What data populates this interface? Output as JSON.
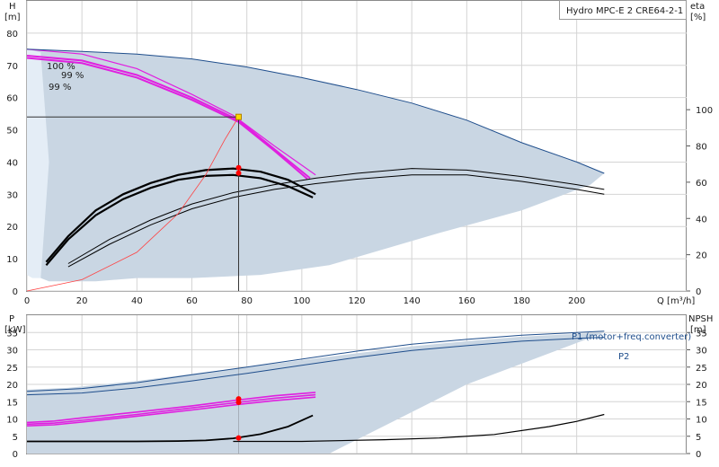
{
  "colors": {
    "area": "#c9d6e3",
    "area_light": "#e4edf6",
    "blue_line": "#1f4e8c",
    "magenta": "#e020e0",
    "black": "#000000",
    "red": "#ff0000",
    "red_curve": "#ff4040",
    "marker_fill": "#ffd700",
    "op_line": "#333333"
  },
  "chart_data": [
    {
      "type": "line",
      "id": "head",
      "title": "Hydro MPC-E 2 CRE64-2-1",
      "ylabel": "H",
      "yunit": "[m]",
      "xlabel": "Q [m³/h]",
      "xlim": [
        0,
        240
      ],
      "ylim": [
        0,
        90
      ],
      "xticks": [
        0,
        20,
        40,
        60,
        80,
        100,
        120,
        140,
        160,
        180,
        200
      ],
      "yticks": [
        0,
        10,
        20,
        30,
        40,
        50,
        60,
        70,
        80
      ],
      "right_axis": {
        "label": "eta",
        "unit": "[%]",
        "ylim": [
          0,
          160
        ],
        "ticks": [
          0,
          20,
          40,
          60,
          80,
          100
        ]
      },
      "grid": true,
      "envelope": [
        [
          0,
          75
        ],
        [
          20,
          74.3
        ],
        [
          40,
          73.5
        ],
        [
          60,
          72
        ],
        [
          80,
          69.5
        ],
        [
          100,
          66.2
        ],
        [
          120,
          62.5
        ],
        [
          140,
          58.3
        ],
        [
          160,
          53
        ],
        [
          180,
          46
        ],
        [
          200,
          40
        ],
        [
          210,
          36.5
        ],
        [
          205,
          33
        ],
        [
          180,
          25
        ],
        [
          150,
          18
        ],
        [
          110,
          8
        ],
        [
          85,
          5
        ],
        [
          60,
          4
        ],
        [
          40,
          4
        ],
        [
          25,
          3
        ],
        [
          15,
          3
        ],
        [
          8,
          3
        ],
        [
          5,
          4
        ],
        [
          2,
          22
        ],
        [
          0,
          70
        ]
      ],
      "envelope_light": [
        [
          0,
          75
        ],
        [
          5,
          74
        ],
        [
          8,
          40
        ],
        [
          5,
          4
        ],
        [
          2,
          4
        ],
        [
          0,
          5
        ]
      ],
      "series": [
        {
          "name": "100 %",
          "color": "magenta",
          "points": [
            [
              0,
              75
            ],
            [
              20,
              73.5
            ],
            [
              40,
              69
            ],
            [
              60,
              61
            ],
            [
              75,
              54.5
            ],
            [
              90,
              45
            ],
            [
              105,
              36
            ]
          ]
        },
        {
          "name": "99 %",
          "color": "magenta",
          "points": [
            [
              0,
              73
            ],
            [
              20,
              71.5
            ],
            [
              40,
              67
            ],
            [
              60,
              60
            ],
            [
              77,
              53
            ],
            [
              90,
              44
            ],
            [
              103,
              35
            ]
          ]
        },
        {
          "name": "99 %",
          "color": "magenta",
          "points": [
            [
              0,
              72.3
            ],
            [
              20,
              70.7
            ],
            [
              40,
              66.2
            ],
            [
              60,
              59.3
            ],
            [
              77,
              52.4
            ],
            [
              90,
              43.5
            ],
            [
              102,
              34.8
            ]
          ]
        },
        {
          "color": "blue_line",
          "points": [
            [
              0,
              75
            ],
            [
              20,
              74.3
            ],
            [
              40,
              73.5
            ],
            [
              60,
              72
            ],
            [
              80,
              69.5
            ],
            [
              100,
              66.2
            ],
            [
              120,
              62.5
            ],
            [
              140,
              58.3
            ],
            [
              160,
              53
            ],
            [
              180,
              46
            ],
            [
              200,
              40
            ],
            [
              210,
              36.5
            ]
          ]
        },
        {
          "color": "black",
          "points": [
            [
              7,
              9
            ],
            [
              15,
              17
            ],
            [
              25,
              25
            ],
            [
              35,
              30
            ],
            [
              45,
              33.5
            ],
            [
              55,
              36
            ],
            [
              65,
              37.5
            ],
            [
              75,
              38
            ],
            [
              85,
              37
            ],
            [
              95,
              34.5
            ],
            [
              105,
              30
            ]
          ]
        },
        {
          "color": "black",
          "points": [
            [
              7,
              8
            ],
            [
              15,
              16
            ],
            [
              25,
              23.5
            ],
            [
              35,
              28.5
            ],
            [
              45,
              32
            ],
            [
              55,
              34.5
            ],
            [
              65,
              35.7
            ],
            [
              75,
              36
            ],
            [
              85,
              35
            ],
            [
              95,
              32.5
            ],
            [
              104,
              29
            ]
          ]
        },
        {
          "color": "black",
          "points": [
            [
              15,
              8.5
            ],
            [
              30,
              16
            ],
            [
              45,
              22
            ],
            [
              60,
              27
            ],
            [
              75,
              30.5
            ],
            [
              90,
              33
            ],
            [
              105,
              35
            ],
            [
              120,
              36.5
            ],
            [
              140,
              38
            ],
            [
              160,
              37.5
            ],
            [
              180,
              35.5
            ],
            [
              200,
              33
            ],
            [
              210,
              31.5
            ]
          ]
        },
        {
          "color": "black",
          "points": [
            [
              15,
              7.5
            ],
            [
              30,
              14.5
            ],
            [
              45,
              20.5
            ],
            [
              60,
              25.5
            ],
            [
              75,
              29
            ],
            [
              90,
              31.5
            ],
            [
              105,
              33.3
            ],
            [
              120,
              34.7
            ],
            [
              140,
              36
            ],
            [
              160,
              36
            ],
            [
              180,
              34
            ],
            [
              200,
              31.5
            ],
            [
              210,
              30
            ]
          ]
        },
        {
          "color": "red_curve",
          "points": [
            [
              0,
              0
            ],
            [
              20,
              3.5
            ],
            [
              40,
              12
            ],
            [
              55,
              24
            ],
            [
              65,
              36
            ],
            [
              72,
              47
            ],
            [
              77,
              54
            ]
          ]
        }
      ],
      "operating_point": {
        "q": 77,
        "h": 54,
        "eta": [
          68,
          65
        ]
      }
    },
    {
      "type": "line",
      "id": "power",
      "ylabel": "P",
      "yunit": "[kW]",
      "xlim": [
        0,
        240
      ],
      "ylim": [
        0,
        40
      ],
      "yticks": [
        0,
        5,
        10,
        15,
        20,
        25,
        30,
        35
      ],
      "right_axis": {
        "label": "NPSH",
        "unit": "[m]",
        "ylim": [
          0,
          40
        ],
        "ticks": [
          0,
          5,
          10,
          15,
          20,
          25,
          30,
          35
        ]
      },
      "grid": true,
      "envelope": [
        [
          0,
          18.5
        ],
        [
          15,
          19
        ],
        [
          40,
          21
        ],
        [
          60,
          23
        ],
        [
          80,
          25
        ],
        [
          100,
          27
        ],
        [
          120,
          29
        ],
        [
          140,
          31
        ],
        [
          160,
          32.5
        ],
        [
          180,
          33.8
        ],
        [
          200,
          34.6
        ],
        [
          210,
          35
        ],
        [
          160,
          20
        ],
        [
          130,
          8
        ],
        [
          110,
          0
        ],
        [
          0,
          0
        ]
      ],
      "series": [
        {
          "name": "P1 (motor+freq.converter)",
          "color": "blue_line",
          "points": [
            [
              0,
              18
            ],
            [
              20,
              18.8
            ],
            [
              40,
              20.5
            ],
            [
              60,
              22.8
            ],
            [
              80,
              25
            ],
            [
              100,
              27.3
            ],
            [
              120,
              29.6
            ],
            [
              140,
              31.6
            ],
            [
              160,
              33
            ],
            [
              180,
              34.2
            ],
            [
              200,
              35
            ],
            [
              210,
              35.4
            ]
          ]
        },
        {
          "name": "P2",
          "color": "blue_line",
          "points": [
            [
              0,
              17
            ],
            [
              20,
              17.5
            ],
            [
              40,
              19
            ],
            [
              60,
              21
            ],
            [
              80,
              23.2
            ],
            [
              100,
              25.5
            ],
            [
              120,
              27.8
            ],
            [
              140,
              29.8
            ],
            [
              160,
              31.2
            ],
            [
              180,
              32.5
            ],
            [
              200,
              33.3
            ],
            [
              210,
              33.6
            ]
          ]
        },
        {
          "color": "magenta",
          "points": [
            [
              0,
              9
            ],
            [
              10,
              9.4
            ],
            [
              20,
              10.3
            ],
            [
              40,
              12
            ],
            [
              60,
              13.8
            ],
            [
              77,
              15.5
            ],
            [
              90,
              16.7
            ],
            [
              105,
              17.7
            ]
          ]
        },
        {
          "color": "magenta",
          "points": [
            [
              0,
              8.5
            ],
            [
              10,
              8.8
            ],
            [
              20,
              9.6
            ],
            [
              40,
              11.3
            ],
            [
              60,
              13.2
            ],
            [
              77,
              14.8
            ],
            [
              90,
              16
            ],
            [
              105,
              17
            ]
          ]
        },
        {
          "color": "magenta",
          "points": [
            [
              0,
              8
            ],
            [
              10,
              8.3
            ],
            [
              20,
              9.1
            ],
            [
              40,
              10.8
            ],
            [
              60,
              12.6
            ],
            [
              77,
              14.2
            ],
            [
              90,
              15.3
            ],
            [
              105,
              16.3
            ]
          ]
        },
        {
          "color": "black",
          "points": [
            [
              0,
              3.5
            ],
            [
              20,
              3.5
            ],
            [
              40,
              3.5
            ],
            [
              55,
              3.6
            ],
            [
              65,
              3.8
            ],
            [
              75,
              4.4
            ],
            [
              85,
              5.6
            ],
            [
              95,
              7.8
            ],
            [
              104,
              11
            ]
          ]
        },
        {
          "color": "black",
          "points": [
            [
              75,
              3.5
            ],
            [
              100,
              3.5
            ],
            [
              130,
              4
            ],
            [
              150,
              4.5
            ],
            [
              170,
              5.5
            ],
            [
              190,
              7.8
            ],
            [
              200,
              9.3
            ],
            [
              210,
              11.3
            ]
          ]
        }
      ],
      "operating_point": {
        "q": 77,
        "p": [
          15.8,
          14.8
        ],
        "npsh": 4.5
      }
    }
  ]
}
